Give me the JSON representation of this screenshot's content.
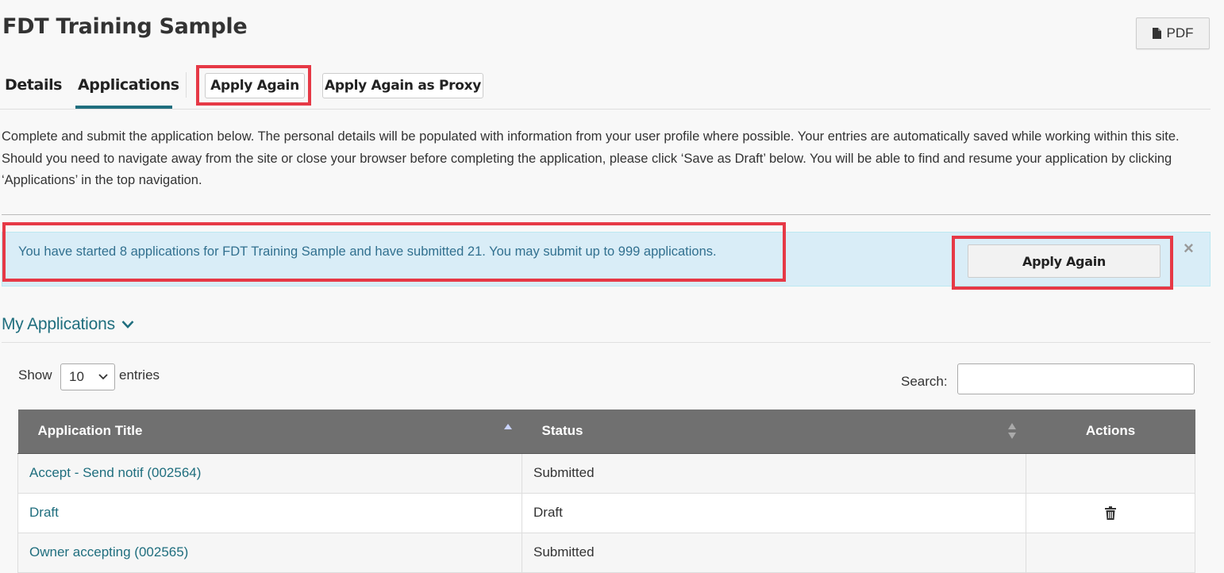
{
  "page": {
    "title": "FDT Training Sample",
    "pdf_label": "PDF"
  },
  "tabs": {
    "details": "Details",
    "applications": "Applications",
    "apply_again": "Apply Again",
    "apply_again_proxy": "Apply Again as Proxy"
  },
  "intro": "Complete and submit the application below. The personal details will be populated with information from your user profile where possible. Your entries are automatically saved while working within this site. Should you need to navigate away from the site or close your browser before completing the application, please click ‘Save as Draft’ below. You will be able to find and resume your application by clicking ‘Applications’ in the top navigation.",
  "alert": {
    "message": "You have started 8 applications for FDT Training Sample and have submitted 21. You may submit up to 999 applications.",
    "button": "Apply Again",
    "close": "×"
  },
  "my_applications": {
    "title": "My Applications",
    "show_label": "Show",
    "entries_value": "10",
    "entries_label": "entries",
    "search_label": "Search:",
    "search_value": "",
    "columns": [
      "Application Title",
      "Status",
      "Actions"
    ],
    "rows": [
      {
        "title": "Accept - Send notif (002564)",
        "status": "Submitted",
        "action": ""
      },
      {
        "title": "Draft",
        "status": "Draft",
        "action": "trash-icon"
      },
      {
        "title": "Owner accepting (002565)",
        "status": "Submitted",
        "action": ""
      }
    ]
  },
  "colors": {
    "accent": "#1f6e7e",
    "alert_bg": "#d9edf7",
    "alert_text": "#31708f",
    "table_header": "#707070",
    "highlight": "#e63946"
  }
}
